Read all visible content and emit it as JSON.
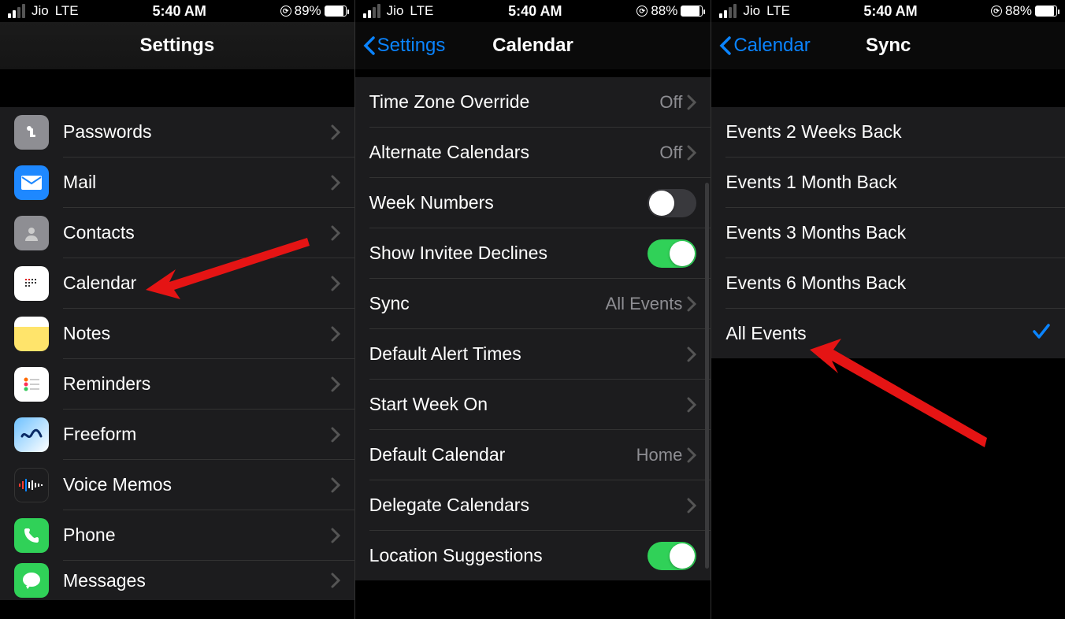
{
  "status": {
    "carrier": "Jio",
    "network": "LTE",
    "time": "5:40 AM",
    "battery1": "89%",
    "battery2": "88%",
    "battery3": "88%"
  },
  "panel1": {
    "title": "Settings",
    "items": [
      {
        "label": "Passwords"
      },
      {
        "label": "Mail"
      },
      {
        "label": "Contacts"
      },
      {
        "label": "Calendar"
      },
      {
        "label": "Notes"
      },
      {
        "label": "Reminders"
      },
      {
        "label": "Freeform"
      },
      {
        "label": "Voice Memos"
      },
      {
        "label": "Phone"
      },
      {
        "label": "Messages"
      }
    ]
  },
  "panel2": {
    "back": "Settings",
    "title": "Calendar",
    "rows": {
      "tzOverride": {
        "label": "Time Zone Override",
        "value": "Off"
      },
      "altCal": {
        "label": "Alternate Calendars",
        "value": "Off"
      },
      "weekNum": {
        "label": "Week Numbers"
      },
      "invitee": {
        "label": "Show Invitee Declines"
      },
      "sync": {
        "label": "Sync",
        "value": "All Events"
      },
      "defAlert": {
        "label": "Default Alert Times"
      },
      "startWeek": {
        "label": "Start Week On"
      },
      "defCal": {
        "label": "Default Calendar",
        "value": "Home"
      },
      "delegate": {
        "label": "Delegate Calendars"
      },
      "location": {
        "label": "Location Suggestions"
      }
    }
  },
  "panel3": {
    "back": "Calendar",
    "title": "Sync",
    "options": [
      {
        "label": "Events 2 Weeks Back"
      },
      {
        "label": "Events 1 Month Back"
      },
      {
        "label": "Events 3 Months Back"
      },
      {
        "label": "Events 6 Months Back"
      },
      {
        "label": "All Events",
        "checked": true
      }
    ]
  }
}
